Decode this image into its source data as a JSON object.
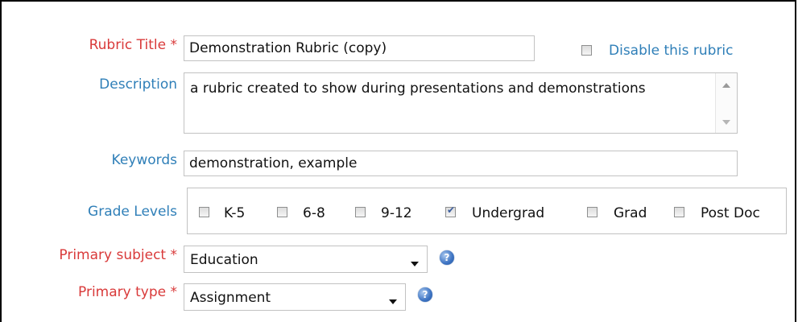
{
  "form": {
    "rubric_title": {
      "label": "Rubric Title *",
      "value": "Demonstration Rubric (copy)"
    },
    "disable": {
      "label": "Disable this rubric",
      "checked": false
    },
    "description": {
      "label": "Description",
      "value": "a rubric created to show during presentations and demonstrations"
    },
    "keywords": {
      "label": "Keywords",
      "value": "demonstration, example"
    },
    "grade_levels": {
      "label": "Grade Levels",
      "options": [
        {
          "label": "K-5",
          "checked": false
        },
        {
          "label": "6-8",
          "checked": false
        },
        {
          "label": "9-12",
          "checked": false
        },
        {
          "label": "Undergrad",
          "checked": true
        },
        {
          "label": "Grad",
          "checked": false
        },
        {
          "label": "Post Doc",
          "checked": false
        }
      ]
    },
    "primary_subject": {
      "label": "Primary subject *",
      "value": "Education"
    },
    "primary_type": {
      "label": "Primary type *",
      "value": "Assignment"
    }
  },
  "icons": {
    "help": "help-icon",
    "dropdown": "chevron-down-icon",
    "scroll_up": "scroll-up-arrow-icon",
    "scroll_down": "scroll-down-arrow-icon"
  },
  "colors": {
    "required_label": "#d93a3a",
    "optional_label": "#2f7fb8",
    "help_icon": "#3b72c2"
  }
}
